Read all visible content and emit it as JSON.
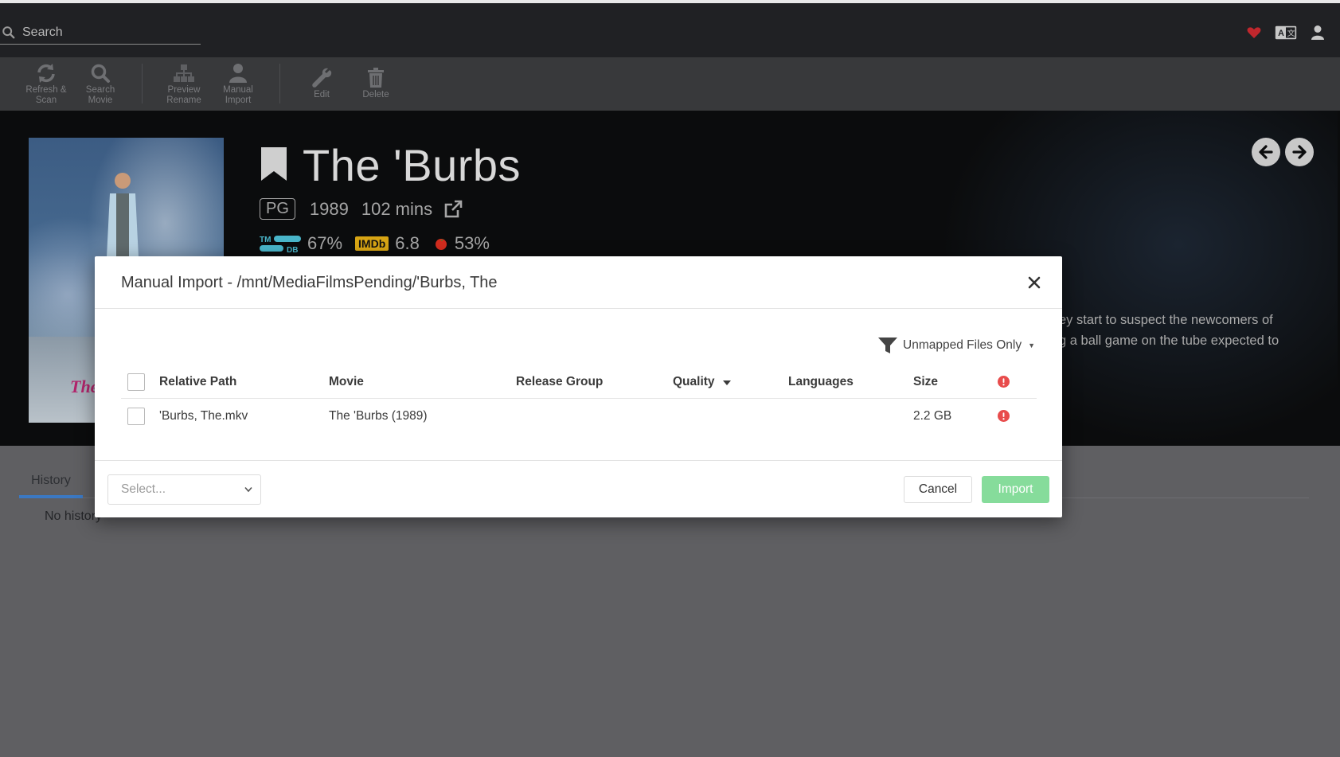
{
  "header": {
    "search_placeholder": "Search"
  },
  "toolbar": {
    "buttons": [
      {
        "label": "Refresh & Scan",
        "icon": "refresh-icon"
      },
      {
        "label": "Search Movie",
        "icon": "search-icon"
      },
      {
        "label": "Preview Rename",
        "icon": "sitemap-icon"
      },
      {
        "label": "Manual Import",
        "icon": "user-icon"
      },
      {
        "label": "Edit",
        "icon": "wrench-icon"
      },
      {
        "label": "Delete",
        "icon": "trash-icon"
      }
    ]
  },
  "movie": {
    "title": "The 'Burbs",
    "certification": "PG",
    "year": "1989",
    "runtime": "102 mins",
    "tmdb_rating": "67%",
    "imdb_label": "IMDb",
    "imdb_rating": "6.8",
    "rt_rating": "53%",
    "overview_line1": "ey start to suspect the newcomers of",
    "overview_line2": "g a ball game on the tube expected to"
  },
  "tabs": {
    "history_label": "History",
    "no_history": "No history"
  },
  "modal": {
    "title": "Manual Import - /mnt/MediaFilmsPending/'Burbs, The",
    "filter_label": "Unmapped Files Only",
    "columns": {
      "relative_path": "Relative Path",
      "movie": "Movie",
      "release_group": "Release Group",
      "quality": "Quality",
      "languages": "Languages",
      "size": "Size"
    },
    "rows": [
      {
        "relative_path": "'Burbs, The.mkv",
        "movie": "The 'Burbs (1989)",
        "release_group": "",
        "quality": "",
        "languages": "",
        "size": "2.2 GB"
      }
    ],
    "select_placeholder": "Select...",
    "cancel_label": "Cancel",
    "import_label": "Import"
  },
  "colors": {
    "accent_tab": "#3b78c2",
    "import_button": "#86dc9b",
    "warning": "#e84c4c",
    "imdb": "#d8a514"
  }
}
